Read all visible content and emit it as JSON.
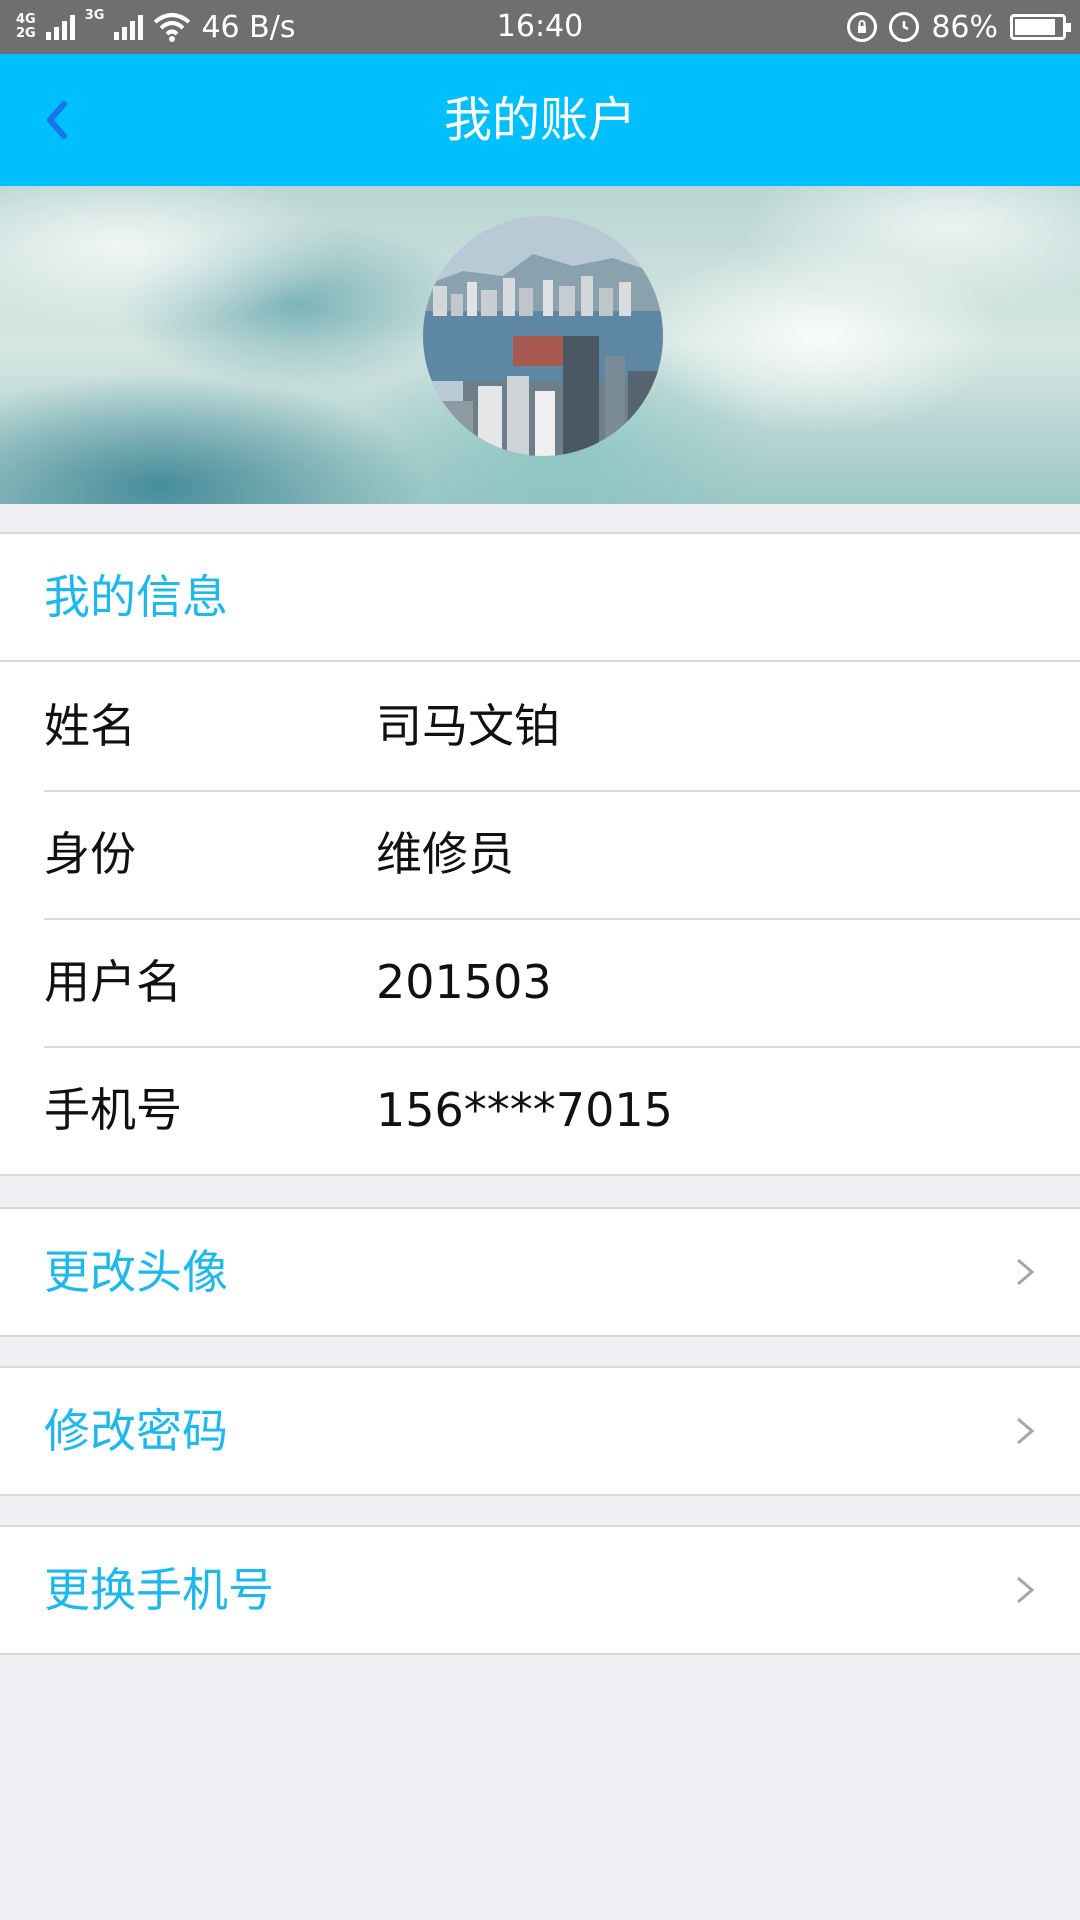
{
  "status_bar": {
    "network_top": "4G",
    "network_bottom": "2G",
    "network_3g": "3G",
    "speed": "46 B/s",
    "time": "16:40",
    "battery": "86%",
    "battery_level": 0.86,
    "icons": [
      "signal-icon",
      "wifi-icon",
      "rotation-lock-icon",
      "alarm-icon",
      "battery-icon"
    ]
  },
  "header": {
    "title": "我的账户",
    "back_icon": "chevron-left-icon",
    "bg_color": "#00bffd"
  },
  "info": {
    "title": "我的信息",
    "rows": [
      {
        "label": "姓名",
        "value": "司马文铂"
      },
      {
        "label": "身份",
        "value": "维修员"
      },
      {
        "label": "用户名",
        "value": "201503"
      },
      {
        "label": "手机号",
        "value": "156****7015"
      }
    ]
  },
  "actions": [
    {
      "label": "更改头像",
      "icon": "chevron-right-icon"
    },
    {
      "label": "修改密码",
      "icon": "chevron-right-icon"
    },
    {
      "label": "更换手机号",
      "icon": "chevron-right-icon"
    }
  ],
  "colors": {
    "accent": "#1eb8ea",
    "page_bg": "#efeff4",
    "divider": "#d9d9d9"
  }
}
